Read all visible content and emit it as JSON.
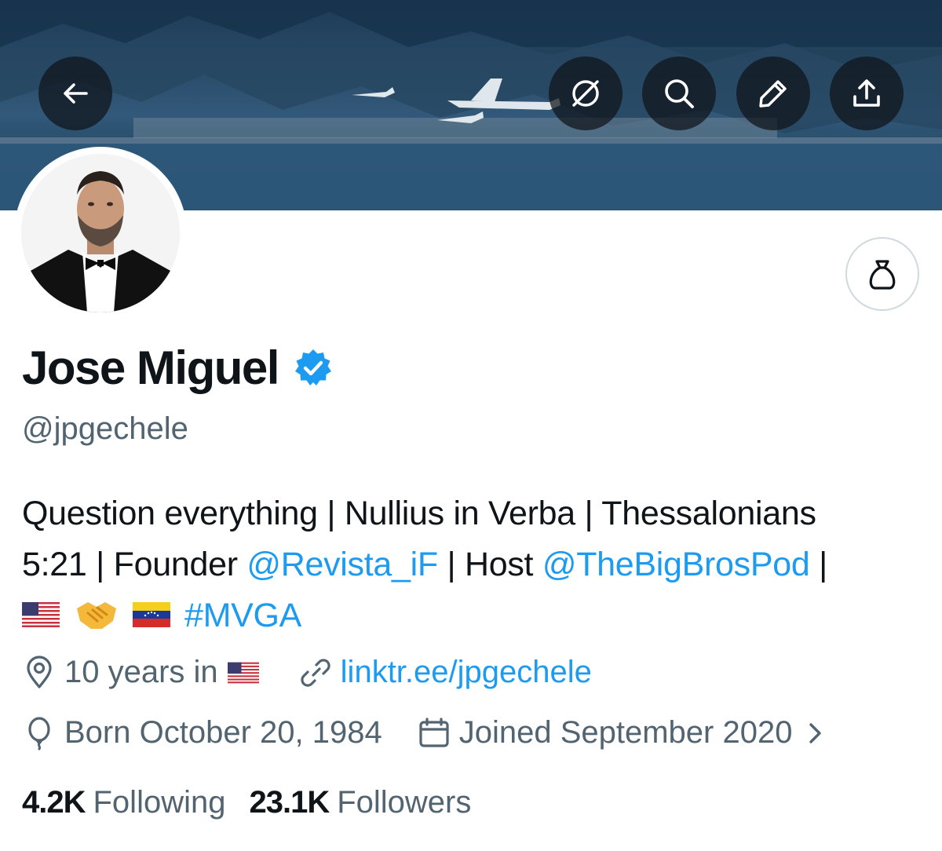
{
  "header": {
    "back_icon": "arrow-left-icon",
    "buttons": [
      "grok-icon",
      "search-icon",
      "edit-icon",
      "share-icon"
    ]
  },
  "profile": {
    "name": "Jose Miguel",
    "verified": true,
    "handle": "@jpgechele",
    "tip_icon": "money-bag-icon",
    "bio": {
      "line1": "Question everything | Nullius in Verba | Thessalonians",
      "line2_prefix": "5:21 | Founder ",
      "line2_link1": "@Revista_iF",
      "line2_mid": " | Host ",
      "line2_link2": "@TheBigBrosPod",
      "line2_suffix": " |",
      "line3_hashtag": "#MVGA"
    },
    "location": "10 years in",
    "website": "linktr.ee/jpgechele",
    "birthday": "Born October 20, 1984",
    "joined": "Joined September 2020"
  },
  "stats": {
    "following_count": "4.2K",
    "following_label": "Following",
    "followers_count": "23.1K",
    "followers_label": "Followers"
  },
  "colors": {
    "link": "#1d9bf0",
    "secondary_text": "#536471",
    "verified": "#1d9bf0"
  }
}
